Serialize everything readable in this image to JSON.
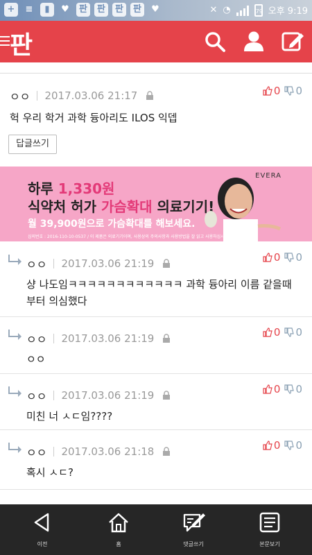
{
  "status_bar": {
    "time": "오후 9:19",
    "battery": "79",
    "notification_icons": [
      "plus-icon",
      "notification-text-icon",
      "document-icon",
      "twitter-icon",
      "pan-app-icon",
      "pan-app-icon",
      "pan-app-icon",
      "pan-app-icon",
      "twitter-icon"
    ]
  },
  "header": {
    "logo": "판",
    "accent_color": "#e5434a"
  },
  "comments": [
    {
      "author": "ㅇㅇ",
      "date": "2017.03.06 21:17",
      "up": "0",
      "down": "0",
      "text": "헉 우리 학거 과학 듕아리도 ILOS 익뎁",
      "reply_button": "답글쓰기",
      "is_reply": false
    }
  ],
  "banner": {
    "brand": "EVERA",
    "line1_prefix": "하루 ",
    "line1_highlight": "1,330원",
    "line2_prefix": "식약처 허가 ",
    "line2_highlight": "가슴확대",
    "line2_suffix": " 의료기기!",
    "line3": "월 39,900원으로 가슴확대를 해보세요.",
    "fine_print": "심의번호 : 2016-110-10-0537 / 이 제품은 의료기기이며, 사용상의 주의사항과 사용방법을 잘 읽고 사용하십시오"
  },
  "replies": [
    {
      "author": "ㅇㅇ",
      "date": "2017.03.06 21:19",
      "up": "0",
      "down": "0",
      "text_line1": "샹 나도임ㅋㅋㅋㅋㅋㅋㅋㅋㅋㅋㅋㅋ 과학 듕아리 이름 같을때",
      "text_line2": "부터 의심했다"
    },
    {
      "author": "ㅇㅇ",
      "date": "2017.03.06 21:19",
      "up": "0",
      "down": "0",
      "text_line1": "ㅇㅇ",
      "text_line2": ""
    },
    {
      "author": "ㅇㅇ",
      "date": "2017.03.06 21:19",
      "up": "0",
      "down": "0",
      "text_line1": "미친 너 ㅅㄷ임????",
      "text_line2": ""
    },
    {
      "author": "ㅇㅇ",
      "date": "2017.03.06 21:18",
      "up": "0",
      "down": "0",
      "text_line1": "혹시 ㅅㄷ?",
      "text_line2": ""
    }
  ],
  "bottom_nav": [
    {
      "label": "이전",
      "icon": "back-triangle-icon"
    },
    {
      "label": "홈",
      "icon": "home-icon"
    },
    {
      "label": "댓글쓰기",
      "icon": "write-comment-icon"
    },
    {
      "label": "본문보기",
      "icon": "view-article-icon"
    }
  ]
}
